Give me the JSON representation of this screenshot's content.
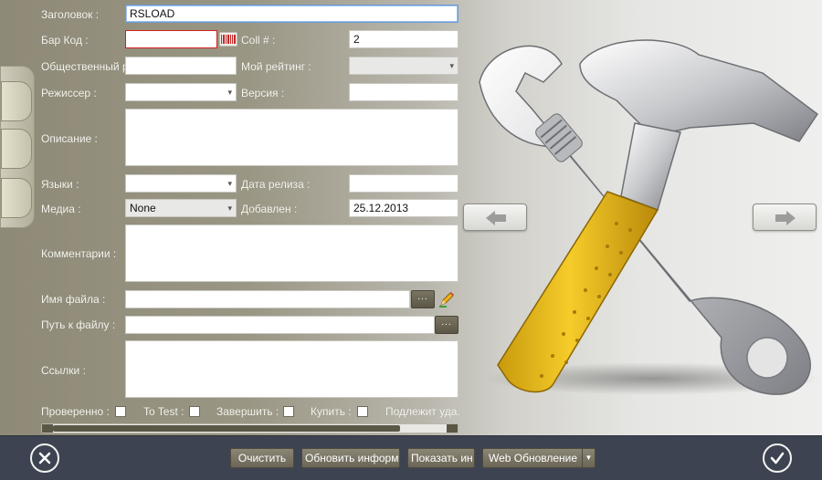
{
  "form": {
    "title_label": "Заголовок :",
    "title_value": "RSLOAD",
    "barcode_label": "Бар Код :",
    "barcode_value": "",
    "coll_label": "Coll # :",
    "coll_value": "2",
    "public_label": "Общественный р",
    "public_value": "",
    "rating_label": "Мой рейтинг :",
    "rating_value": "",
    "director_label": "Режиссер :",
    "director_value": "",
    "version_label": "Версия :",
    "version_value": "",
    "description_label": "Описание :",
    "languages_label": "Языки :",
    "languages_value": "",
    "release_label": "Дата релиза :",
    "release_value": "",
    "media_label": "Медиа :",
    "media_value": "None",
    "added_label": "Добавлен :",
    "added_value": "25.12.2013",
    "comments_label": "Комментарии :",
    "filename_label": "Имя файла :",
    "filename_value": "",
    "filepath_label": "Путь к файлу :",
    "filepath_value": "",
    "links_label": "Ссылки :",
    "browse_label": "...",
    "checks": {
      "verified": "Проверенно :",
      "to_test": "To Test :",
      "finish": "Завершить :",
      "buy": "Купить :",
      "delete": "Подлежит уда."
    }
  },
  "toolbar": {
    "clear": "Очистить",
    "update_info": "Обновить информ",
    "show": "Показать ин",
    "web_update": "Web Обновление"
  },
  "icons": {
    "close": "close-circle-icon",
    "ok": "checkmark-circle-icon",
    "barcode": "barcode-icon",
    "edit": "pencil-icon",
    "prev": "left-arrow-icon",
    "next": "right-arrow-icon",
    "dropdown": "chevron-down-icon"
  },
  "colors": {
    "bottom_bar": "#3d4350",
    "button": "#7a7462",
    "error_border": "#d02020",
    "focus_border": "#6a9bd8"
  }
}
